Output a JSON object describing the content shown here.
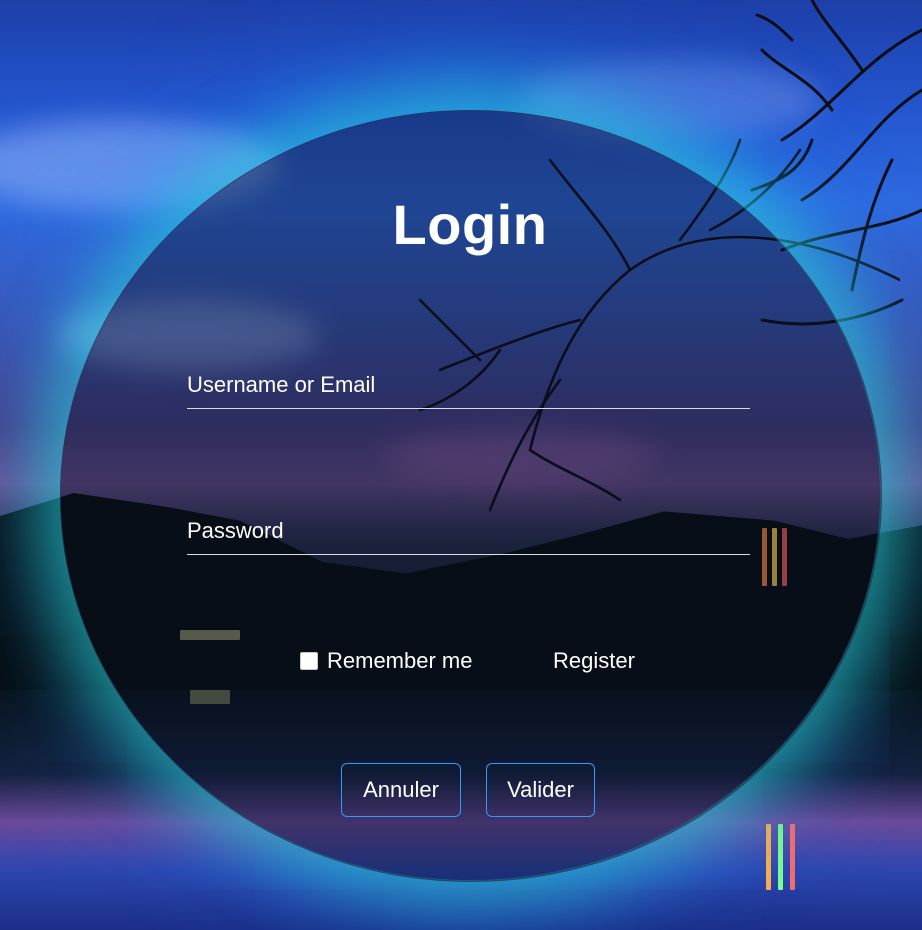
{
  "login_form": {
    "title": "Login",
    "username_label": "Username or Email",
    "password_label": "Password",
    "remember_label": "Remember me",
    "remember_checked": false,
    "register_link": "Register",
    "cancel_button": "Annuler",
    "submit_button": "Valider"
  },
  "colors": {
    "accent_border": "#2f9bff",
    "glow": "#28dcd2",
    "text": "#ffffff",
    "underline": "#d7dfe8"
  }
}
